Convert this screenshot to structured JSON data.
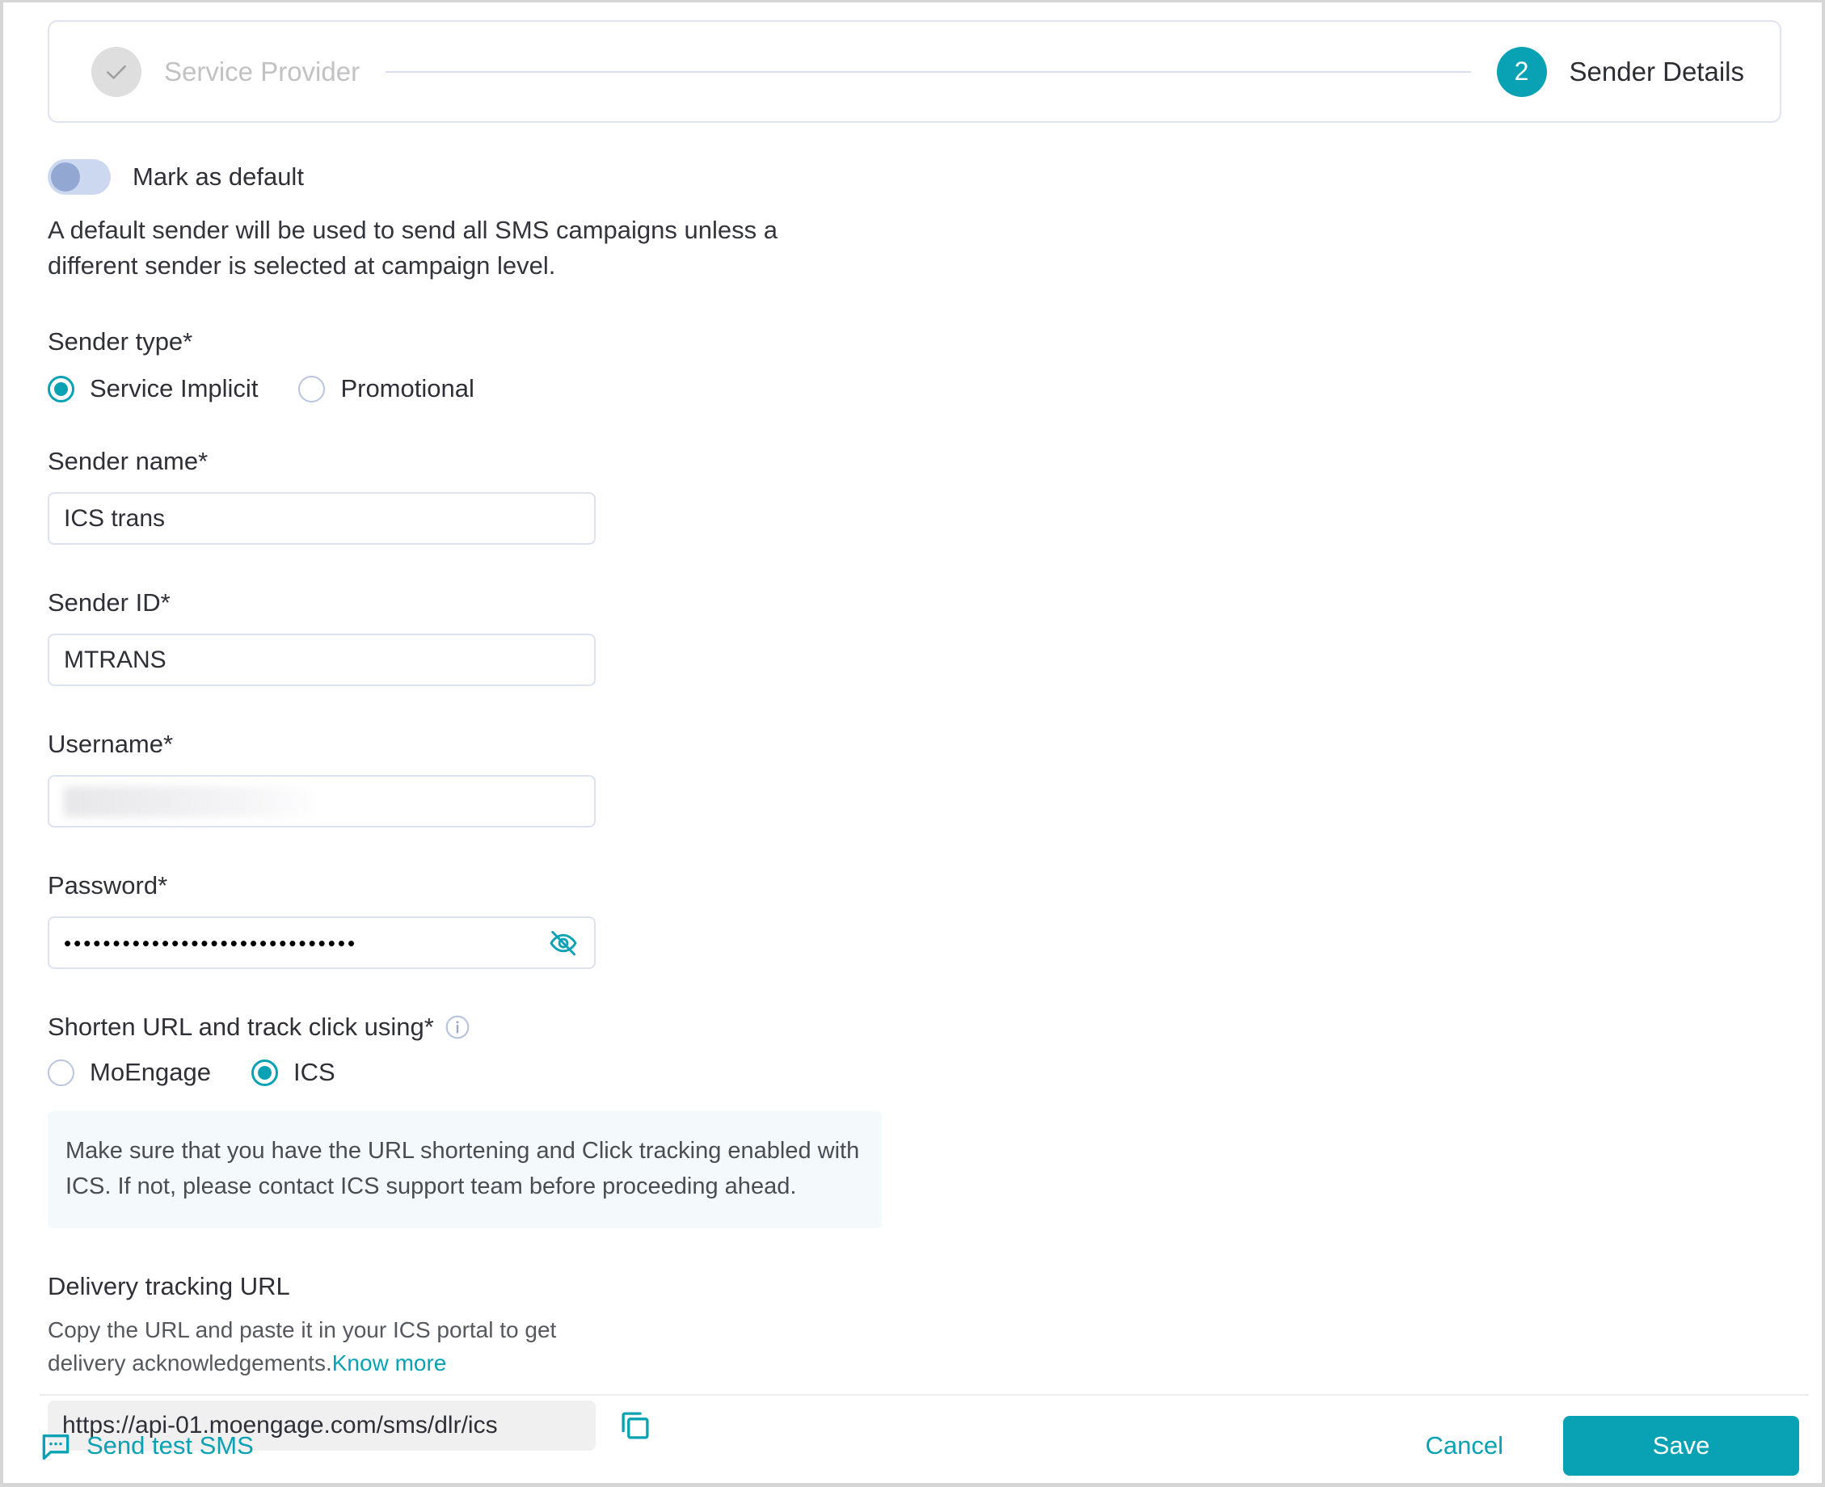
{
  "stepper": {
    "steps": [
      {
        "label": "Service Provider",
        "state": "completed",
        "indicator": "check-icon"
      },
      {
        "label": "Sender Details",
        "state": "active",
        "indicator": "2"
      }
    ]
  },
  "form": {
    "mark_as_default": {
      "label": "Mark as default",
      "enabled": false,
      "description": "A default sender will be used to send all SMS campaigns unless a different sender is selected at campaign level."
    },
    "sender_type": {
      "label": "Sender type*",
      "options": [
        {
          "label": "Service Implicit",
          "selected": true
        },
        {
          "label": "Promotional",
          "selected": false
        }
      ]
    },
    "sender_name": {
      "label": "Sender name*",
      "value": "ICS trans",
      "placeholder": ""
    },
    "sender_id": {
      "label": "Sender ID*",
      "value": "MTRANS",
      "placeholder": ""
    },
    "username": {
      "label": "Username*",
      "value": "",
      "placeholder": "",
      "redacted": true
    },
    "password": {
      "label": "Password*",
      "value": "••••••••••••••••••••••••••••••",
      "masked": true,
      "toggle_icon": "eye-off-icon"
    },
    "shorten_url": {
      "label": "Shorten URL and track click using*",
      "info_icon": "info-icon",
      "options": [
        {
          "label": "MoEngage",
          "selected": false
        },
        {
          "label": "ICS",
          "selected": true
        }
      ],
      "note": "Make sure that you have the URL shortening and Click tracking enabled with ICS. If not, please contact ICS support team before proceeding ahead."
    },
    "delivery_tracking": {
      "label": "Delivery tracking URL",
      "description": "Copy the URL and paste it in your ICS portal to get delivery acknowledgements.",
      "link_label": "Know more",
      "url": "https://api-01.moengage.com/sms/dlr/ics",
      "copy_icon": "copy-icon"
    }
  },
  "footer": {
    "send_test_label": "Send test SMS",
    "send_test_icon": "sms-bubble-icon",
    "cancel_label": "Cancel",
    "save_label": "Save"
  },
  "colors": {
    "accent": "#09a2b4",
    "border": "#dde2f0",
    "note_bg": "#f4f9fb",
    "toggle_track": "#ccd8ef",
    "toggle_knob": "#92a8d2",
    "readonly_bg": "#f0f0f0"
  }
}
